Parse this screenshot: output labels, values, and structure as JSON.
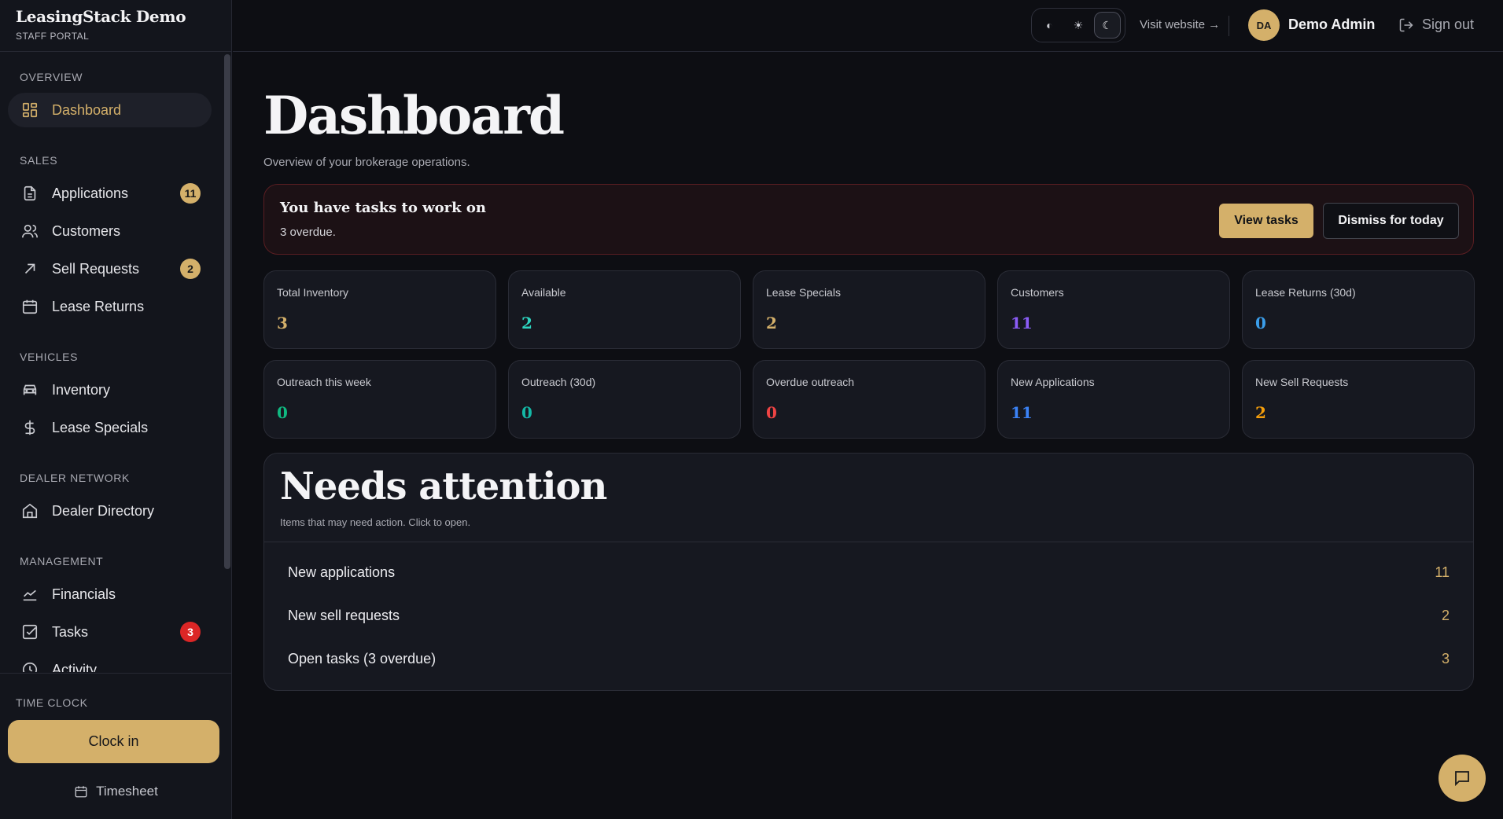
{
  "brand": {
    "name": "LeasingStack Demo",
    "subtitle": "STAFF PORTAL"
  },
  "sidebar": {
    "sections": {
      "overview": "OVERVIEW",
      "sales": "SALES",
      "vehicles": "VEHICLES",
      "dealer_network": "DEALER NETWORK",
      "management": "MANAGEMENT"
    },
    "items": {
      "dashboard": {
        "label": "Dashboard",
        "icon": "grid-icon"
      },
      "applications": {
        "label": "Applications",
        "icon": "document-icon",
        "badge": "11"
      },
      "customers": {
        "label": "Customers",
        "icon": "users-icon"
      },
      "sell_requests": {
        "label": "Sell Requests",
        "icon": "arrow-up-right-icon",
        "badge": "2"
      },
      "lease_returns": {
        "label": "Lease Returns",
        "icon": "calendar-icon"
      },
      "inventory": {
        "label": "Inventory",
        "icon": "car-icon"
      },
      "lease_specials": {
        "label": "Lease Specials",
        "icon": "dollar-icon"
      },
      "dealer_directory": {
        "label": "Dealer Directory",
        "icon": "home-icon"
      },
      "financials": {
        "label": "Financials",
        "icon": "trend-icon"
      },
      "tasks": {
        "label": "Tasks",
        "icon": "checkbox-icon",
        "badge": "3"
      },
      "activity": {
        "label": "Activity",
        "icon": "clock-icon"
      }
    },
    "time_clock": {
      "label": "TIME CLOCK",
      "clock_in": "Clock in",
      "timesheet": "Timesheet"
    }
  },
  "topbar": {
    "theme": {
      "system": "◐",
      "light": "☀",
      "dark": "☾"
    },
    "visit_website": "Visit website →",
    "user": {
      "initials": "DA",
      "name": "Demo Admin"
    },
    "sign_out": "Sign out"
  },
  "page": {
    "title": "Dashboard",
    "subtitle": "Overview of your brokerage operations."
  },
  "alert": {
    "title": "You have tasks to work on",
    "subtitle": "3 overdue.",
    "view_tasks": "View tasks",
    "dismiss": "Dismiss for today"
  },
  "stats": [
    {
      "label": "Total Inventory",
      "value": "3",
      "color": "#d4b06a"
    },
    {
      "label": "Available",
      "value": "2",
      "color": "#2dd4bf"
    },
    {
      "label": "Lease Specials",
      "value": "2",
      "color": "#d4b06a"
    },
    {
      "label": "Customers",
      "value": "11",
      "color": "#8b5cf6"
    },
    {
      "label": "Lease Returns (30d)",
      "value": "0",
      "color": "#3b9eea"
    },
    {
      "label": "Outreach this week",
      "value": "0",
      "color": "#10b981"
    },
    {
      "label": "Outreach (30d)",
      "value": "0",
      "color": "#14b8a6"
    },
    {
      "label": "Overdue outreach",
      "value": "0",
      "color": "#ef4444"
    },
    {
      "label": "New Applications",
      "value": "11",
      "color": "#3b82f6"
    },
    {
      "label": "New Sell Requests",
      "value": "2",
      "color": "#f59e0b"
    }
  ],
  "attention": {
    "title": "Needs attention",
    "subtitle": "Items that may need action. Click to open.",
    "rows": [
      {
        "label": "New applications",
        "count": "11"
      },
      {
        "label": "New sell requests",
        "count": "2"
      },
      {
        "label": "Open tasks (3 overdue)",
        "count": "3"
      }
    ]
  }
}
